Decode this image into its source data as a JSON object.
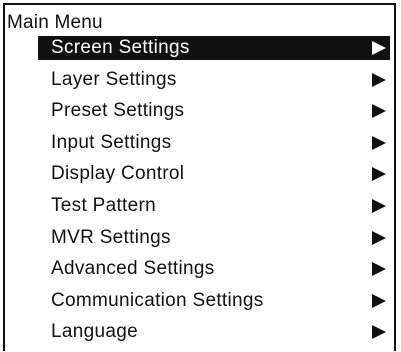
{
  "menu": {
    "title": "Main Menu",
    "items": [
      {
        "label": "Screen Settings",
        "selected": true
      },
      {
        "label": "Layer Settings",
        "selected": false
      },
      {
        "label": "Preset Settings",
        "selected": false
      },
      {
        "label": "Input Settings",
        "selected": false
      },
      {
        "label": "Display Control",
        "selected": false
      },
      {
        "label": "Test Pattern",
        "selected": false
      },
      {
        "label": "MVR Settings",
        "selected": false
      },
      {
        "label": "Advanced Settings",
        "selected": false
      },
      {
        "label": "Communication Settings",
        "selected": false
      },
      {
        "label": "Language",
        "selected": false
      }
    ],
    "submenu_icon": "triangle-right-icon",
    "colors": {
      "foreground": "#111111",
      "background": "#ffffff",
      "highlight": "#111111",
      "highlight_text": "#ffffff"
    }
  }
}
